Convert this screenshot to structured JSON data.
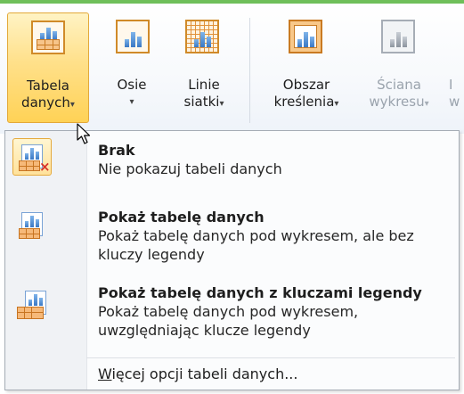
{
  "ribbon": {
    "buttons": [
      {
        "line1": "Tabela",
        "line2": "danych",
        "arrow": "▾",
        "state": "active",
        "icon": "data-table-icon"
      },
      {
        "line1": "Osie",
        "line2": "",
        "arrow": "▾",
        "state": "normal",
        "icon": "axes-icon"
      },
      {
        "line1": "Linie",
        "line2": "siatki",
        "arrow": "▾",
        "state": "normal",
        "icon": "gridlines-icon"
      },
      {
        "line1": "Obszar",
        "line2": "kreślenia",
        "arrow": "▾",
        "state": "normal",
        "icon": "plot-area-icon"
      },
      {
        "line1": "Ściana",
        "line2": "wykresu",
        "arrow": "▾",
        "state": "disabled",
        "icon": "chart-wall-icon"
      },
      {
        "line1": "I",
        "line2": "w",
        "arrow": "",
        "state": "disabled",
        "icon": ""
      }
    ]
  },
  "menu": {
    "items": [
      {
        "title": "Brak",
        "desc": "Nie pokazuj tabeli danych",
        "icon": "no-data-table-icon"
      },
      {
        "title": "Pokaż tabelę danych",
        "desc": "Pokaż tabelę danych pod wykresem, ale bez kluczy legendy",
        "icon": "show-data-table-icon"
      },
      {
        "title": "Pokaż tabelę danych z kluczami legendy",
        "desc": "Pokaż tabelę danych pod wykresem, uwzględniając klucze legendy",
        "icon": "show-data-table-legend-keys-icon"
      }
    ],
    "more_prefix": "W",
    "more_rest": "ięcej opcji tabeli danych..."
  },
  "colors": {
    "accent_highlight": "#ffd256",
    "highlight_border": "#e3a93a",
    "ribbon_top": "#6fbf5a"
  }
}
